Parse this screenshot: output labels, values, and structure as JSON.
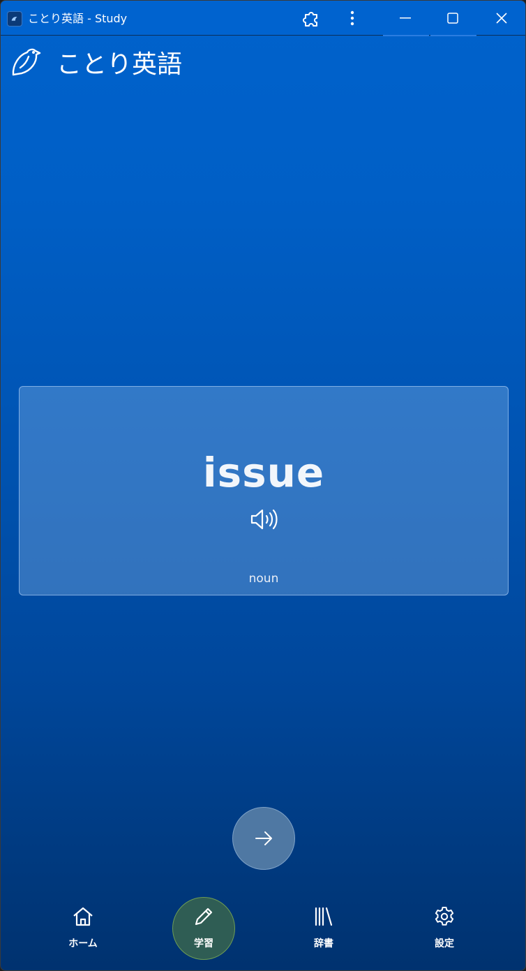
{
  "window": {
    "title": "ことり英語 - Study",
    "controls": [
      "extensions-icon",
      "more-icon",
      "minimize-icon",
      "maximize-icon",
      "close-icon"
    ]
  },
  "header": {
    "brand": "ことり英語",
    "logo_icon": "bird-icon"
  },
  "card": {
    "word": "issue",
    "part_of_speech": "noun",
    "audio_icon": "speaker-icon"
  },
  "next_button": {
    "icon": "arrow-right-icon"
  },
  "nav": {
    "items": [
      {
        "label": "ホーム",
        "icon": "home-icon",
        "active": false
      },
      {
        "label": "学習",
        "icon": "pencil-icon",
        "active": true
      },
      {
        "label": "辞書",
        "icon": "library-icon",
        "active": false
      },
      {
        "label": "設定",
        "icon": "gear-icon",
        "active": false
      }
    ]
  },
  "colors": {
    "background_top": "#0062cc",
    "background_bottom": "#00326f",
    "active_nav": "#2f5d54",
    "active_nav_border": "#6e9d54",
    "card": "#5a93d4"
  }
}
